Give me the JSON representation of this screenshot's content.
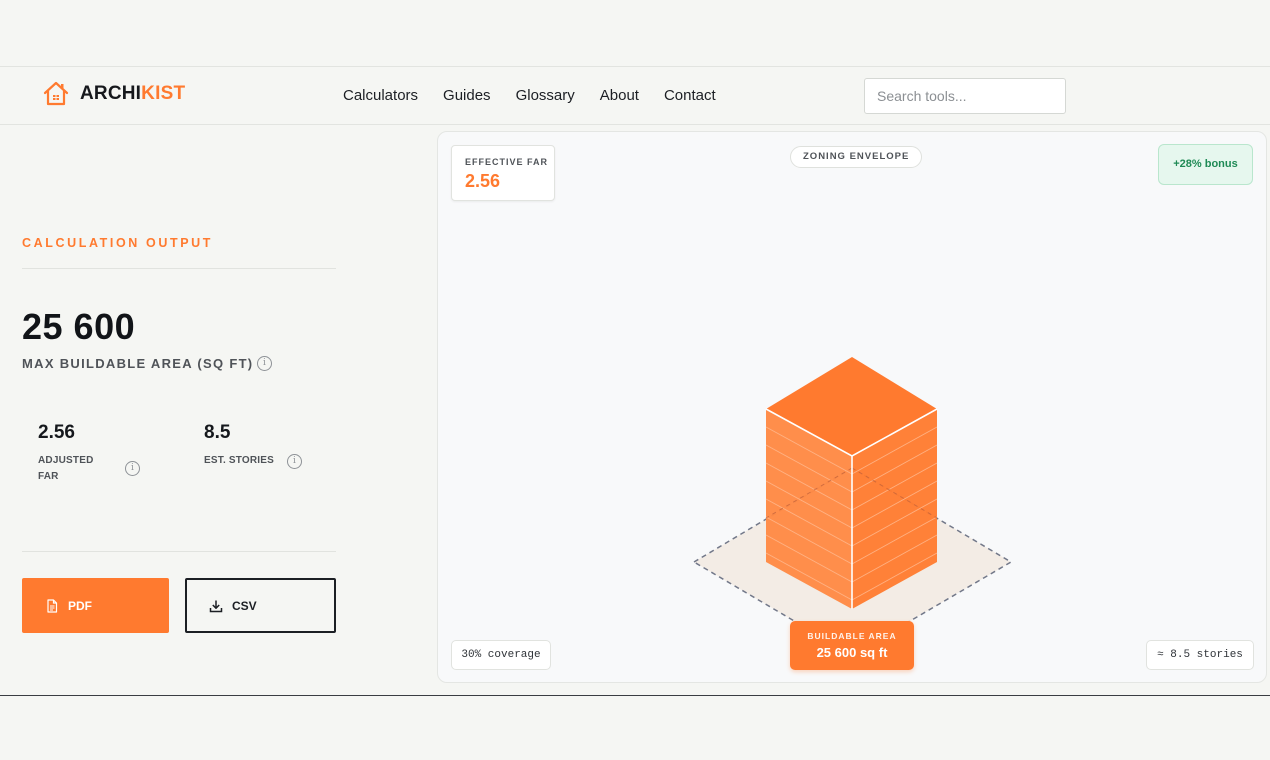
{
  "brand": {
    "part1": "ARCHI",
    "part2": "KIST",
    "accent": "#ff7a2f"
  },
  "nav": {
    "items": [
      "Calculators",
      "Guides",
      "Glossary",
      "About",
      "Contact"
    ]
  },
  "search": {
    "placeholder": "Search tools..."
  },
  "output": {
    "eyebrow": "CALCULATION OUTPUT",
    "max_area_value": "25 600",
    "max_area_label": "MAX BUILDABLE AREA (SQ FT)",
    "stats": [
      {
        "value": "2.56",
        "label_line1": "ADJUSTED",
        "label_line2": "FAR"
      },
      {
        "value": "8.5",
        "label_line1": "EST. STORIES",
        "label_line2": ""
      }
    ],
    "pdf_label": "PDF",
    "csv_label": "CSV"
  },
  "viz": {
    "effective_far_label": "EFFECTIVE FAR",
    "effective_far_value": "2.56",
    "zoning_label": "ZONING ENVELOPE",
    "bonus_label": "+28% bonus",
    "coverage_label": "30% coverage",
    "stories_label": "≈ 8.5 stories",
    "area_label": "BUILDABLE AREA",
    "area_value": "25 600 sq ft"
  },
  "icons": {
    "logo": "house-icon",
    "info": "info-icon",
    "pdf": "document-icon",
    "csv": "download-icon"
  },
  "colors": {
    "accent": "#ff7a2f",
    "bonus_green": "#1f8a55",
    "text": "#1c1f24"
  }
}
